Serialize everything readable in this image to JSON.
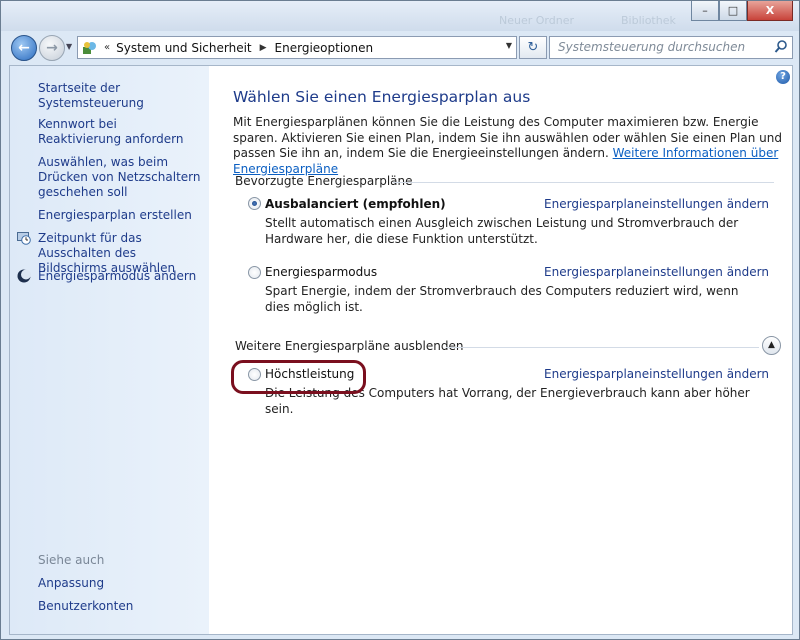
{
  "titlebar": {
    "ghost_items": [
      "Neuer Ordner",
      "Bibliothek"
    ],
    "minimize": "–",
    "maximize": "□",
    "close": "X"
  },
  "nav": {
    "chevrons": "«",
    "breadcrumb": [
      "System und Sicherheit",
      "Energieoptionen"
    ],
    "search_placeholder": "Systemsteuerung durchsuchen"
  },
  "sidebar": {
    "home": "Startseite der Systemsteuerung",
    "items": [
      "Kennwort bei Reaktivierung anfordern",
      "Auswählen, was beim Drücken von Netzschaltern geschehen soll",
      "Energiesparplan erstellen",
      "Zeitpunkt für das Ausschalten des Bildschirms auswählen",
      "Energiesparmodus ändern"
    ],
    "see_also_title": "Siehe auch",
    "see_also": [
      "Anpassung",
      "Benutzerkonten"
    ]
  },
  "main": {
    "title": "Wählen Sie einen Energiesparplan aus",
    "intro_text": "Mit Energiesparplänen können Sie die Leistung des Computer maximieren bzw. Energie sparen. Aktivieren Sie einen Plan, indem Sie ihn auswählen oder wählen Sie einen Plan und passen Sie ihn an, indem Sie die Energieeinstellungen ändern. ",
    "intro_link": "Weitere Informationen über Energiesparpläne",
    "preferred_section": "Bevorzugte Energiesparpläne",
    "more_section": "Weitere Energiesparpläne ausblenden",
    "change_link": "Energiesparplaneinstellungen ändern",
    "plans": [
      {
        "name": "Ausbalanciert (empfohlen)",
        "selected": true,
        "description": "Stellt automatisch einen Ausgleich zwischen Leistung und Stromverbrauch der Hardware her, die diese Funktion unterstützt."
      },
      {
        "name": "Energiesparmodus",
        "selected": false,
        "description": "Spart Energie, indem der Stromverbrauch des Computers reduziert wird, wenn dies möglich ist."
      },
      {
        "name": "Höchstleistung",
        "selected": false,
        "description": "Die Leistung des Computers hat Vorrang, der Energieverbrauch kann aber höher sein."
      }
    ]
  }
}
